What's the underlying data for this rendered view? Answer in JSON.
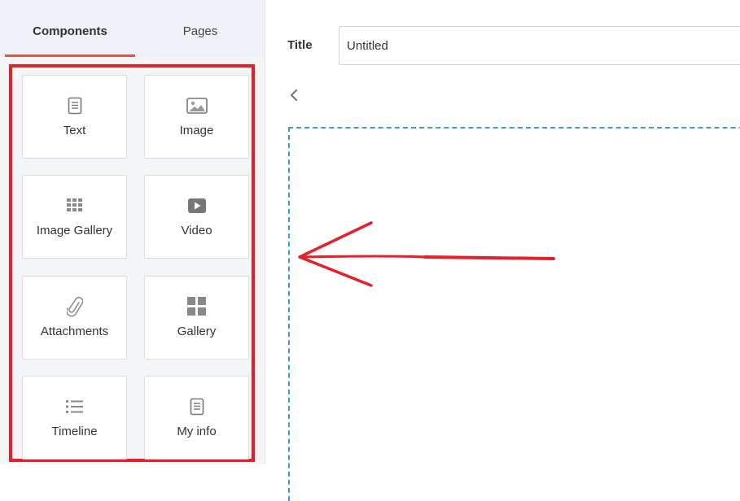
{
  "tabs": {
    "components": "Components",
    "pages": "Pages"
  },
  "components": [
    {
      "label": "Text",
      "icon": "document-icon"
    },
    {
      "label": "Image",
      "icon": "image-icon"
    },
    {
      "label": "Image Gallery",
      "icon": "grid-dots-icon"
    },
    {
      "label": "Video",
      "icon": "video-play-icon"
    },
    {
      "label": "Attachments",
      "icon": "paperclip-icon"
    },
    {
      "label": "Gallery",
      "icon": "four-squares-icon"
    },
    {
      "label": "Timeline",
      "icon": "list-icon"
    },
    {
      "label": "My info",
      "icon": "document-icon"
    }
  ],
  "editor": {
    "title_label": "Title",
    "title_value": "Untitled"
  },
  "colors": {
    "highlight": "#e6202b",
    "tab_accent": "#e0574a",
    "dropzone_border": "#3a9ad9",
    "icon_gray": "#888888"
  }
}
